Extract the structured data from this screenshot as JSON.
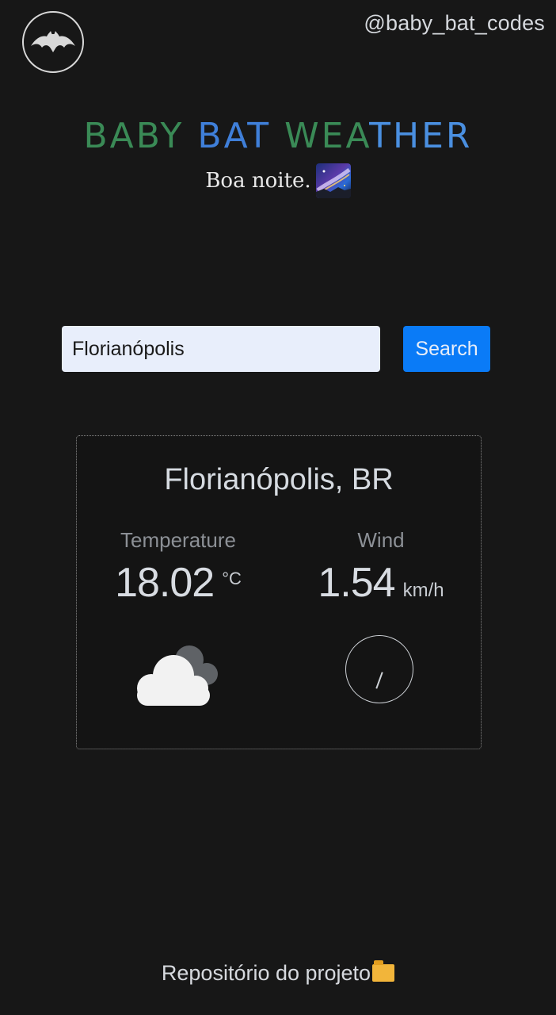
{
  "header": {
    "logo_icon": "bat-icon",
    "handle": "@baby_bat_codes"
  },
  "hero": {
    "title_parts": [
      "BABY",
      "BAT",
      "WEA",
      "THER"
    ],
    "greeting": "Boa noite.",
    "greeting_icon": "milky-way-emoji-icon"
  },
  "search": {
    "value": "Florianópolis",
    "button_label": "Search"
  },
  "weather_card": {
    "location": "Florianópolis, BR",
    "temperature_label": "Temperature",
    "temperature_value": "18.02",
    "temperature_unit": "°C",
    "wind_label": "Wind",
    "wind_value": "1.54",
    "wind_unit": "km/h",
    "condition_icon": "cloudy-icon",
    "wind_direction_icon": "compass-icon"
  },
  "footer": {
    "link_label": "Repositório do projeto",
    "link_icon": "folder-icon"
  },
  "colors": {
    "background": "#171717",
    "accent": "#0a7bf7",
    "title_green": "#3a8a56",
    "title_blue": "#3f7fd9",
    "input_bg": "#e8eefb"
  }
}
